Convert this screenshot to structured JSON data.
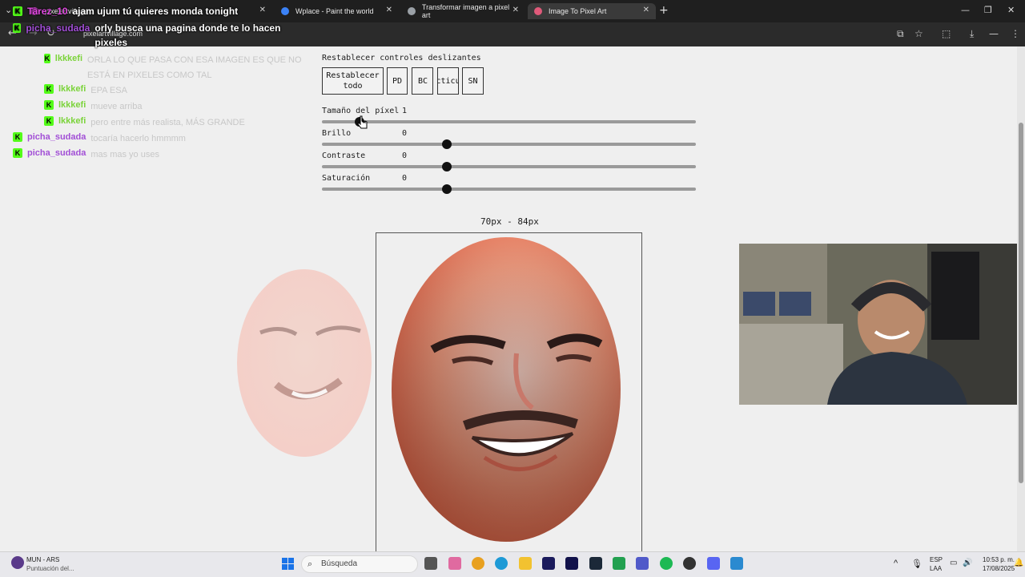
{
  "browser": {
    "tabs": [
      {
        "label": "pixelartvillage...",
        "active": false
      },
      {
        "label": "Wplace - Paint the world",
        "active": false
      },
      {
        "label": "Transformar imagen a pixel art",
        "active": false
      },
      {
        "label": "Image To Pixel Art",
        "active": true
      }
    ],
    "url": "pixelartvillage.com"
  },
  "chat_overlay": {
    "top_messages": [
      {
        "user": "Tarez_10",
        "text": "ajam ujum tú quieres monda tonight",
        "color": "#e04ae0"
      },
      {
        "user": "picha_sudada",
        "text": "orly busca una pagina donde te lo hacen pixeles",
        "color": "#a24fd6"
      }
    ],
    "messages": [
      {
        "user": "lkkkefi",
        "text": "ORLA LO QUE PASA CON ESA IMAGEN ES QUE NO ESTÁ EN PIXELES COMO TAL",
        "color": "#7bd33a"
      },
      {
        "user": "lkkkefi",
        "text": "EPA ESA",
        "color": "#7bd33a"
      },
      {
        "user": "lkkkefi",
        "text": "mueve arriba",
        "color": "#7bd33a"
      },
      {
        "user": "lkkkefi",
        "text": "pero entre más realista, MÁS GRANDE",
        "color": "#7bd33a"
      },
      {
        "user": "picha_sudada",
        "text": "tocaría hacerlo hmmmm",
        "color": "#a24fd6"
      },
      {
        "user": "picha_sudada",
        "text": "mas mas yo uses",
        "color": "#a24fd6"
      }
    ]
  },
  "controls": {
    "reset_sliders_title": "Restablecer controles deslizantes",
    "buttons": [
      {
        "label": "Restablecer todo"
      },
      {
        "label": "PD"
      },
      {
        "label": "BC"
      },
      {
        "label": "Connecticut"
      },
      {
        "label": "SN"
      }
    ],
    "sliders": [
      {
        "label": "Tamaño del píxel",
        "value": "1",
        "fraction": 0.1
      },
      {
        "label": "Brillo",
        "value": "0",
        "fraction": 0.335
      },
      {
        "label": "Contraste",
        "value": "0",
        "fraction": 0.335
      },
      {
        "label": "Saturación",
        "value": "0",
        "fraction": 0.335
      }
    ]
  },
  "preview": {
    "dimensions": "70px - 84px"
  },
  "taskbar": {
    "weather_title": "MUN - ARS",
    "weather_sub": "Puntuación del...",
    "search_placeholder": "Búsqueda",
    "lang_line1": "ESP",
    "lang_line2": "LAA",
    "time": "10:53 p. m.",
    "date": "17/08/2025"
  }
}
